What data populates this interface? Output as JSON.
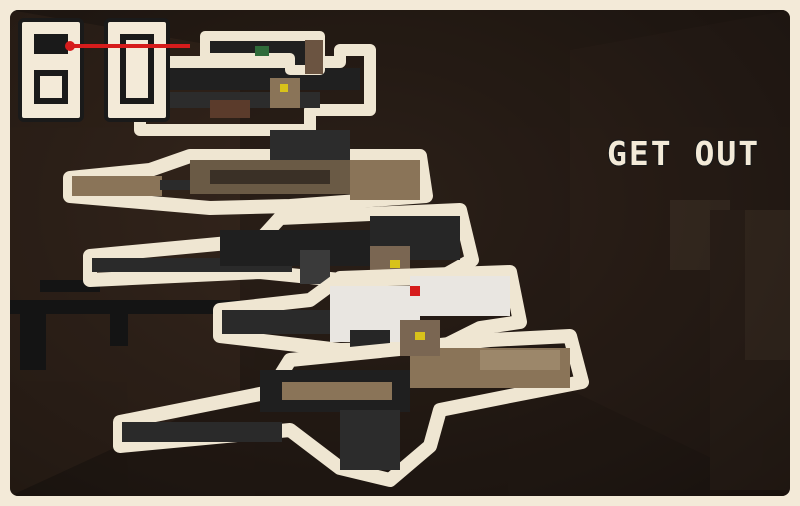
{
  "logo": {
    "subtitle": "GET OUT"
  },
  "colors": {
    "frame": "#f3ead8",
    "outline": "#efe6d2",
    "tan": "#8a7458",
    "dark": "#232323",
    "mid": "#3a3a3a",
    "white_plush": "#e9e6e1",
    "eye_yellow": "#d8c21a",
    "laser_red": "#d61c1c"
  },
  "icons": [
    "sniper-rifle-icon",
    "assault-rifle-icon",
    "smg-icon",
    "lmg-icon",
    "scoped-rifle-icon",
    "pistol-icon"
  ]
}
